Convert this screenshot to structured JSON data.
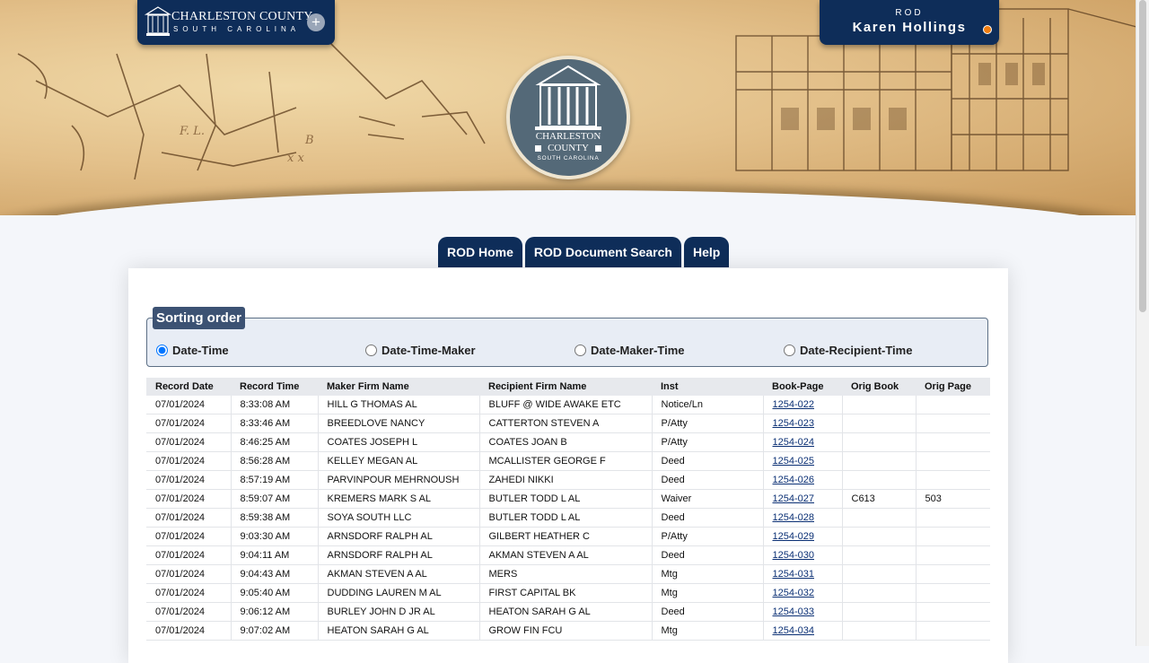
{
  "header": {
    "logo": {
      "line1": "CHARLESTON COUNTY",
      "line2": "SOUTH CAROLINA"
    },
    "user": {
      "department": "ROD",
      "name": "Karen Hollings"
    },
    "seal": {
      "line1": "CHARLESTON",
      "line2": "COUNTY",
      "line3": "SOUTH CAROLINA"
    }
  },
  "tabs": [
    "ROD Home",
    "ROD Document Search",
    "Help"
  ],
  "sorting": {
    "legend": "Sorting order",
    "options": [
      "Date-Time",
      "Date-Time-Maker",
      "Date-Maker-Time",
      "Date-Recipient-Time"
    ],
    "selected": "Date-Time"
  },
  "table": {
    "columns": [
      "Record Date",
      "Record Time",
      "Maker Firm Name",
      "Recipient Firm Name",
      "Inst",
      "Book-Page",
      "Orig Book",
      "Orig Page"
    ],
    "rows": [
      [
        "07/01/2024",
        "8:33:08 AM",
        "HILL G THOMAS AL",
        "BLUFF @ WIDE AWAKE ETC",
        "Notice/Ln",
        "1254-022",
        "",
        ""
      ],
      [
        "07/01/2024",
        "8:33:46 AM",
        "BREEDLOVE NANCY",
        "CATTERTON STEVEN A",
        "P/Atty",
        "1254-023",
        "",
        ""
      ],
      [
        "07/01/2024",
        "8:46:25 AM",
        "COATES JOSEPH L",
        "COATES JOAN B",
        "P/Atty",
        "1254-024",
        "",
        ""
      ],
      [
        "07/01/2024",
        "8:56:28 AM",
        "KELLEY MEGAN AL",
        "MCALLISTER GEORGE F",
        "Deed",
        "1254-025",
        "",
        ""
      ],
      [
        "07/01/2024",
        "8:57:19 AM",
        "PARVINPOUR MEHRNOUSH",
        "ZAHEDI NIKKI",
        "Deed",
        "1254-026",
        "",
        ""
      ],
      [
        "07/01/2024",
        "8:59:07 AM",
        "KREMERS MARK S AL",
        "BUTLER TODD L AL",
        "Waiver",
        "1254-027",
        "C613",
        "503"
      ],
      [
        "07/01/2024",
        "8:59:38 AM",
        "SOYA SOUTH LLC",
        "BUTLER TODD L AL",
        "Deed",
        "1254-028",
        "",
        ""
      ],
      [
        "07/01/2024",
        "9:03:30 AM",
        "ARNSDORF RALPH AL",
        "GILBERT HEATHER C",
        "P/Atty",
        "1254-029",
        "",
        ""
      ],
      [
        "07/01/2024",
        "9:04:11 AM",
        "ARNSDORF RALPH AL",
        "AKMAN STEVEN A AL",
        "Deed",
        "1254-030",
        "",
        ""
      ],
      [
        "07/01/2024",
        "9:04:43 AM",
        "AKMAN STEVEN A AL",
        "MERS",
        "Mtg",
        "1254-031",
        "",
        ""
      ],
      [
        "07/01/2024",
        "9:05:40 AM",
        "DUDDING LAUREN M AL",
        "FIRST CAPITAL BK",
        "Mtg",
        "1254-032",
        "",
        ""
      ],
      [
        "07/01/2024",
        "9:06:12 AM",
        "BURLEY JOHN D JR AL",
        "HEATON SARAH G AL",
        "Deed",
        "1254-033",
        "",
        ""
      ],
      [
        "07/01/2024",
        "9:07:02 AM",
        "HEATON SARAH G AL",
        "GROW FIN FCU",
        "Mtg",
        "1254-034",
        "",
        ""
      ]
    ]
  },
  "colors": {
    "navy": "#0e2d59",
    "legend_bg": "#3c5273",
    "fieldset_bg": "#e8edf5",
    "header_row_bg": "#e7e9ed",
    "link": "#0a2f74",
    "status_dot": "#f07d10"
  }
}
